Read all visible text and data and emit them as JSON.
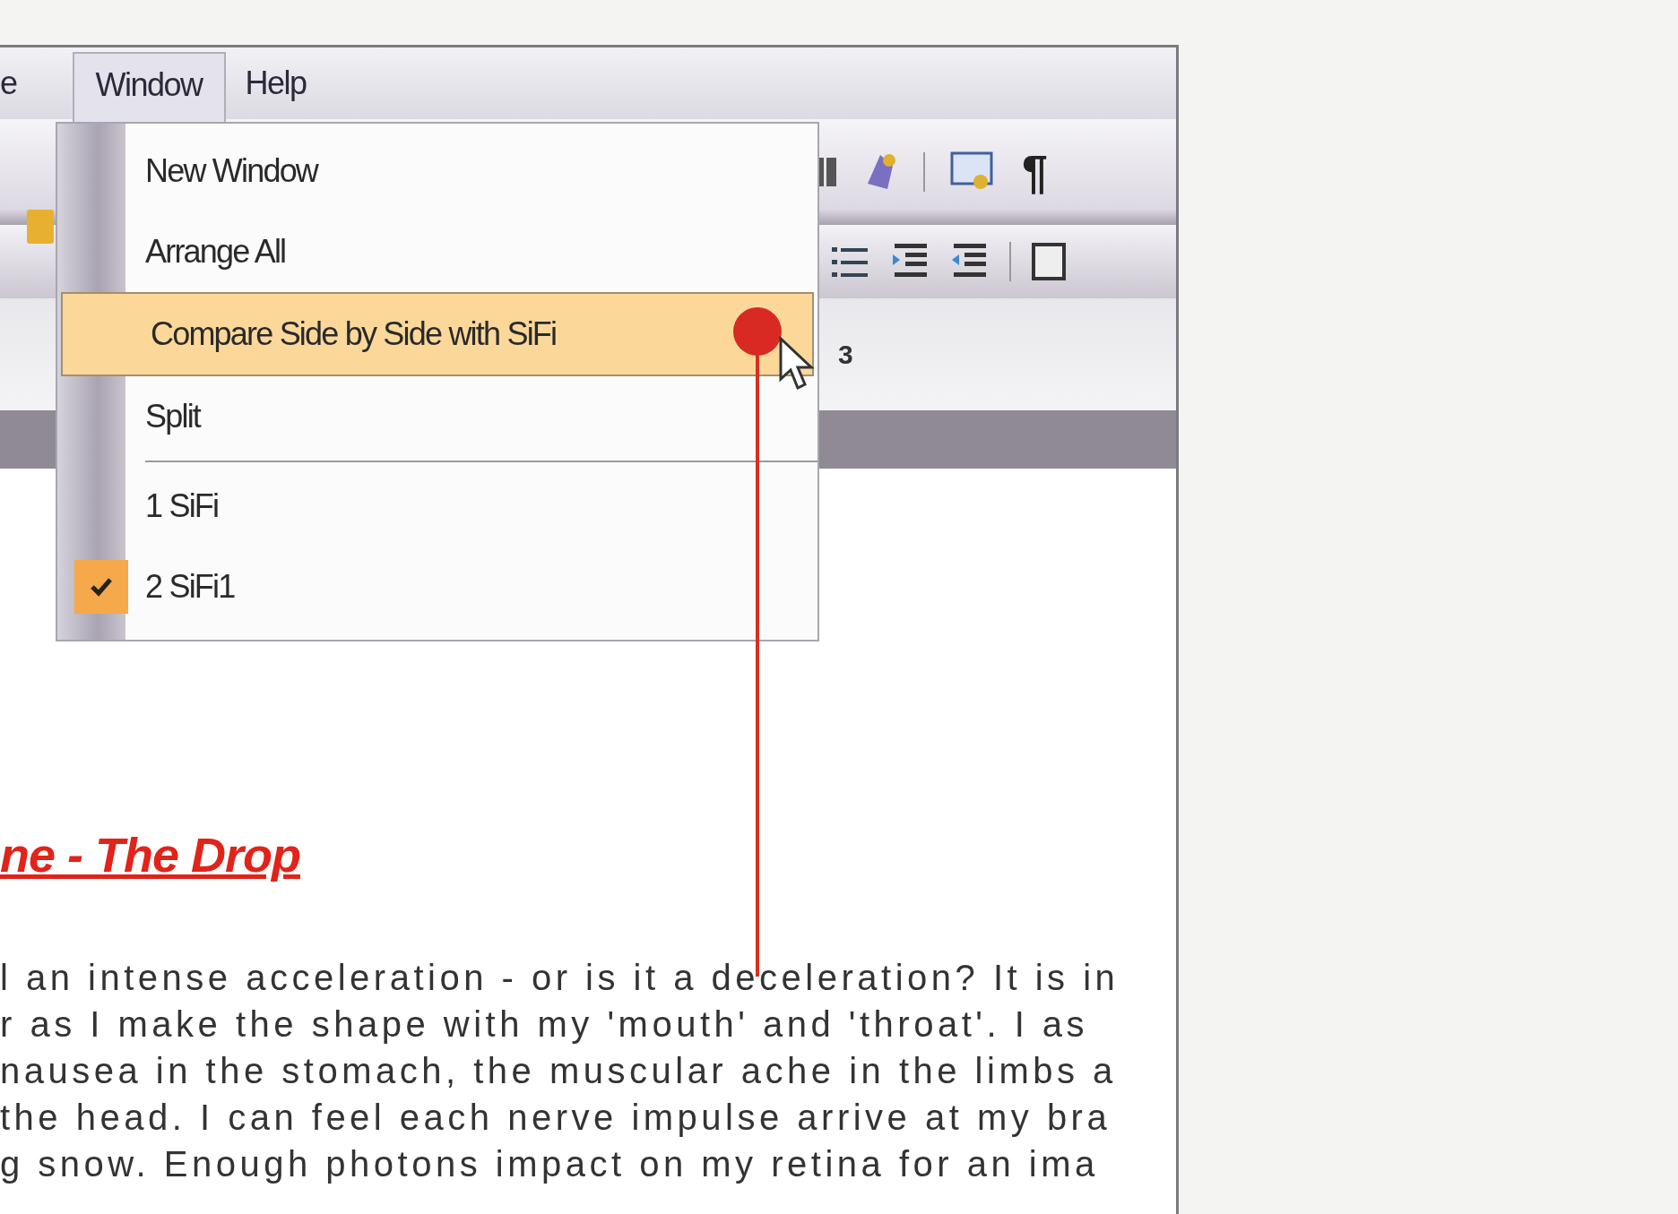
{
  "menu_bar": {
    "items": [
      {
        "label": "e",
        "selected": false
      },
      {
        "label": "Window",
        "selected": true
      },
      {
        "label": "Help",
        "selected": false
      }
    ]
  },
  "window_menu": {
    "items": [
      {
        "kind": "item",
        "label": "New Window",
        "selected": false,
        "checked": false
      },
      {
        "kind": "item",
        "label": "Arrange All",
        "selected": false,
        "checked": false
      },
      {
        "kind": "item",
        "label": "Compare Side by Side with SiFi",
        "selected": true,
        "checked": false
      },
      {
        "kind": "item",
        "label": "Split",
        "selected": false,
        "checked": false
      },
      {
        "kind": "separator"
      },
      {
        "kind": "item",
        "label": "1 SiFi",
        "selected": false,
        "checked": false
      },
      {
        "kind": "item",
        "label": "2 SiFi1",
        "selected": false,
        "checked": true
      }
    ]
  },
  "ruler": {
    "label": "3"
  },
  "toolbar": {
    "pilcrow": "¶"
  },
  "document": {
    "heading": "ne - The Drop",
    "lines": [
      "l an intense acceleration - or is it a deceleration? It is in",
      "r as I make the shape with my 'mouth' and 'throat'. I as",
      "nausea in the stomach, the muscular ache in the limbs a",
      "the head. I can feel each nerve impulse arrive at my bra",
      "g snow. Enough photons impact on my retina for an ima"
    ]
  }
}
